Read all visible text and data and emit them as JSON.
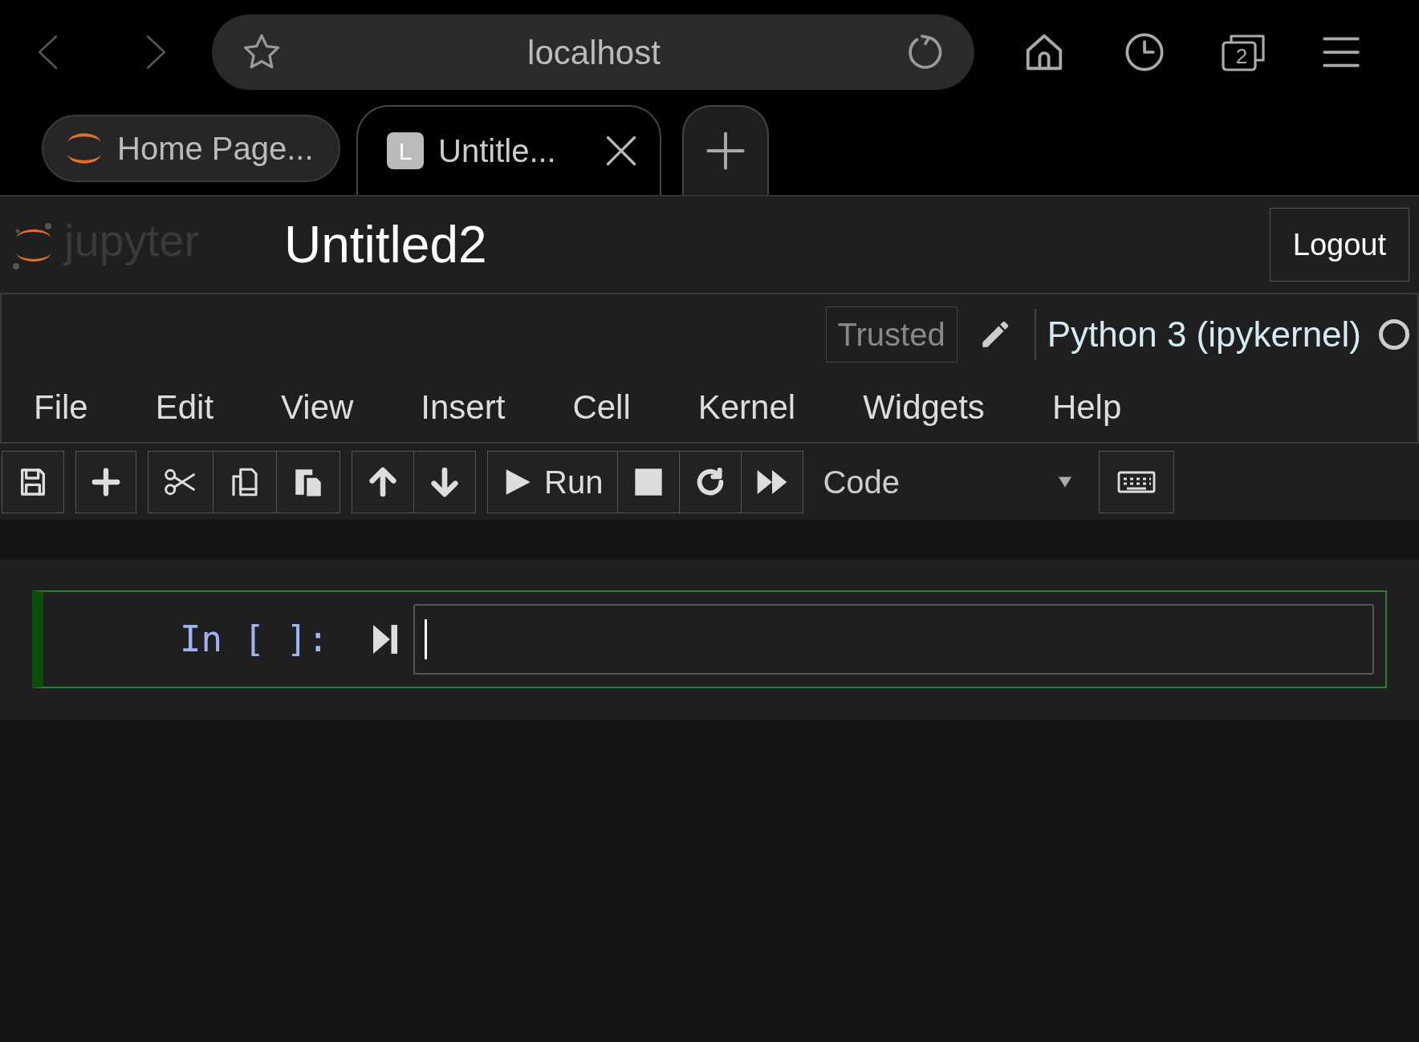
{
  "browser": {
    "url": "localhost",
    "tab_count": "2",
    "tabs": [
      {
        "title": "Home Page...",
        "kind": "jupyter",
        "selected": false
      },
      {
        "title": "Untitle...",
        "kind": "letter",
        "favicon_letter": "L",
        "selected": true
      }
    ]
  },
  "header": {
    "logo_text": "jupyter",
    "notebook_title": "Untitled2",
    "logout": "Logout"
  },
  "kernel": {
    "trusted": "Trusted",
    "name": "Python 3 (ipykernel)",
    "busy": false
  },
  "menus": [
    "File",
    "Edit",
    "View",
    "Insert",
    "Cell",
    "Kernel",
    "Widgets",
    "Help"
  ],
  "toolbar": [
    [
      {
        "kind": "save"
      }
    ],
    [
      {
        "kind": "add"
      }
    ],
    [
      {
        "kind": "cut"
      },
      {
        "kind": "copy"
      },
      {
        "kind": "paste"
      }
    ],
    [
      {
        "kind": "up"
      },
      {
        "kind": "down"
      }
    ],
    [
      {
        "kind": "run",
        "label": "Run"
      },
      {
        "kind": "stop"
      },
      {
        "kind": "restart"
      },
      {
        "kind": "forward"
      }
    ]
  ],
  "cell_type": "Code",
  "cells": [
    {
      "prompt": "In [ ]:",
      "selected": true
    }
  ]
}
